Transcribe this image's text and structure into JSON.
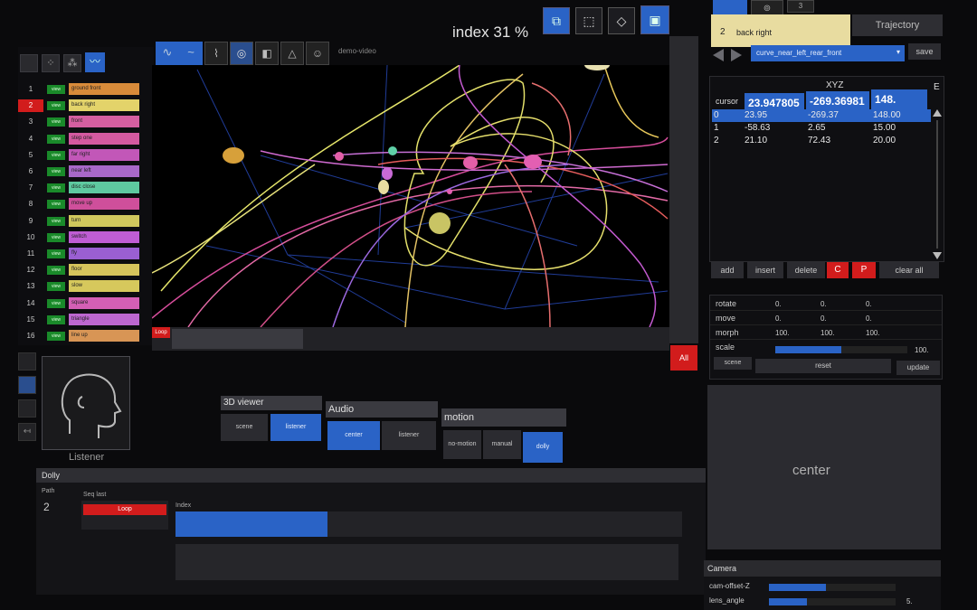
{
  "viewer": {
    "title": "index 31 %",
    "video_label": "demo-video",
    "all_button": "All",
    "loop_button": "Loop"
  },
  "sources": [
    {
      "num": "1",
      "name": "ground front",
      "color": "#d88b3a"
    },
    {
      "num": "2",
      "name": "back right",
      "color": "#e3d36a"
    },
    {
      "num": "3",
      "name": "front",
      "color": "#d55fa0"
    },
    {
      "num": "4",
      "name": "step one",
      "color": "#d45aa0"
    },
    {
      "num": "5",
      "name": "far right",
      "color": "#c257b8"
    },
    {
      "num": "6",
      "name": "near left",
      "color": "#a868c8"
    },
    {
      "num": "7",
      "name": "disc close",
      "color": "#5ec9a0"
    },
    {
      "num": "8",
      "name": "move up",
      "color": "#cf4f9b"
    },
    {
      "num": "9",
      "name": "turn",
      "color": "#d0c85d"
    },
    {
      "num": "10",
      "name": "switch",
      "color": "#bf5dd4"
    },
    {
      "num": "11",
      "name": "fly",
      "color": "#9a5fd2"
    },
    {
      "num": "12",
      "name": "floor",
      "color": "#d6c45c"
    },
    {
      "num": "13",
      "name": "slow",
      "color": "#d6c85c"
    },
    {
      "num": "14",
      "name": "square",
      "color": "#d45fb5"
    },
    {
      "num": "15",
      "name": "triangle",
      "color": "#bd67d0"
    },
    {
      "num": "16",
      "name": "line up",
      "color": "#d89555"
    }
  ],
  "view_label": "view",
  "listener_caption": "Listener",
  "groups": {
    "viewer3d": {
      "title": "3D viewer",
      "buttons": [
        "scene",
        "listener"
      ]
    },
    "audio": {
      "title": "Audio",
      "buttons": [
        "center",
        "listener"
      ]
    },
    "motion": {
      "title": "motion",
      "buttons": [
        "no-motion",
        "manual",
        "dolly"
      ]
    }
  },
  "dolly": {
    "title": "Dolly",
    "path_label": "Path",
    "path_value": "2",
    "seq_label": "Seq last",
    "seq_button": "Loop",
    "index_label": "Index",
    "index_fraction": 0.3
  },
  "right_panel": {
    "track_number": "2",
    "track_name": "back right",
    "trajectory_tab": "Trajectory",
    "tab_number": "3",
    "curve_select": "curve_near_left_rear_front",
    "save_button": "save",
    "xyz_header": "XYZ",
    "e_header": "E",
    "cursor_label": "cursor",
    "cursor_values": [
      "23.947805",
      "-269.36981",
      "148."
    ],
    "table_rows": [
      {
        "idx": "0",
        "x": "23.95",
        "y": "-269.37",
        "z": "148.00"
      },
      {
        "idx": "1",
        "x": "-58.63",
        "y": "2.65",
        "z": "15.00"
      },
      {
        "idx": "2",
        "x": "21.10",
        "y": "72.43",
        "z": "20.00"
      }
    ],
    "actions": [
      "add",
      "insert",
      "delete",
      "C",
      "P",
      "clear all"
    ],
    "transforms": [
      {
        "label": "rotate",
        "values": [
          "0.",
          "0.",
          "0."
        ]
      },
      {
        "label": "move",
        "values": [
          "0.",
          "0.",
          "0."
        ]
      },
      {
        "label": "morph",
        "values": [
          "100.",
          "100.",
          "100."
        ]
      }
    ],
    "scale_label": "scale",
    "scale_value": "100.",
    "scale_fraction": 0.5,
    "footer_buttons": [
      "scene",
      "reset",
      "update"
    ],
    "center_label": "center"
  },
  "camera": {
    "title": "Camera",
    "rows": [
      {
        "label": "cam-offset-Z",
        "value": "",
        "fraction": 0.45
      },
      {
        "label": "lens_angle",
        "value": "5.",
        "fraction": 0.3
      }
    ]
  },
  "colors": {
    "accent": "#2a63c6",
    "alert": "#d21c1c",
    "highlight": "#e8dca0"
  }
}
